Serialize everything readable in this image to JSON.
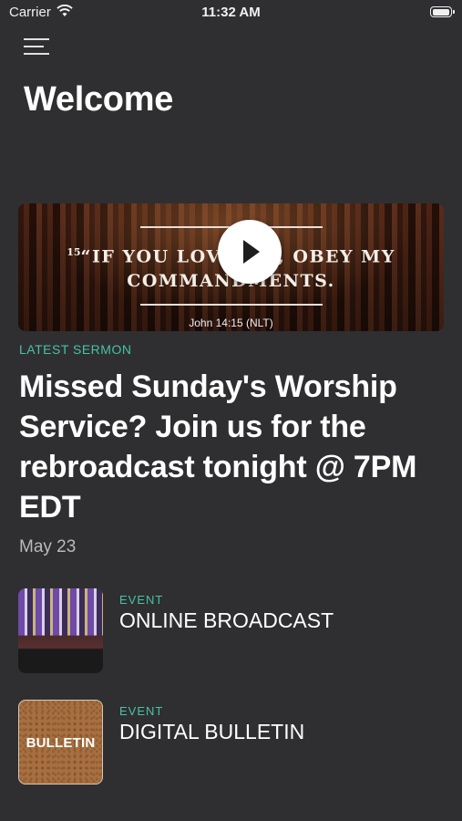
{
  "status_bar": {
    "carrier": "Carrier",
    "time": "11:32 AM",
    "battery_level": 1.0
  },
  "header": {
    "title": "Welcome",
    "menu_icon": "hamburger-menu-icon"
  },
  "hero": {
    "verse_number": "15",
    "verse_line1": "“IF YOU LOVE ME, OBEY MY",
    "verse_line2": "COMMANDMENTS.",
    "reference": "John 14:15 (NLT)",
    "play_icon": "play-icon"
  },
  "latest_sermon": {
    "kicker": "LATEST SERMON",
    "headline": "Missed Sunday's Worship Service? Join us for the rebroadcast tonight @ 7PM EDT",
    "date": "May 23"
  },
  "events": [
    {
      "tag": "EVENT",
      "title": "ONLINE BROADCAST"
    },
    {
      "tag": "EVENT",
      "title": "DIGITAL BULLETIN",
      "thumb_text": "BULLETIN"
    }
  ],
  "colors": {
    "background": "#2f2f31",
    "accent": "#47c2a6",
    "secondary_text": "#b9b9bb"
  }
}
